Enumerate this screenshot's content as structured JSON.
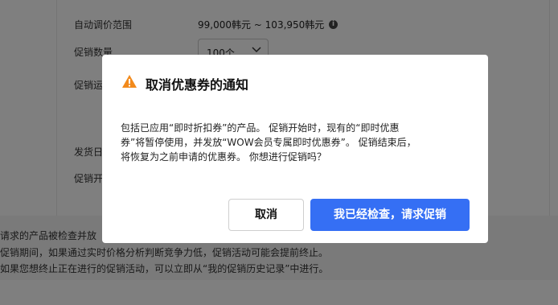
{
  "background": {
    "rows": [
      {
        "label": "自动调价范围",
        "value": "99,000韩元 ~ 103,950韩元"
      },
      {
        "label": "促销数量",
        "value": "100个"
      },
      {
        "label": "促销运",
        "value": ""
      },
      {
        "label": "发货日",
        "value": ""
      },
      {
        "label": "促销开",
        "value": ""
      }
    ],
    "notice_lines": [
      "请求的产品被检查并放",
      "促销期间，如果通过实时价格分析判断竞争力低，促销活动可能会提前终止。",
      "如果您想终止正在进行的促销活动，可以立即从“我的促销历史记录”中进行。"
    ]
  },
  "modal": {
    "title": "取消优惠券的通知",
    "body_lines": [
      "包括已应用“即时折扣券”的产品。 促销开始时，现有的“即时优惠",
      "券”将暂停使用，并发放“WOW会员专属即时优惠券”。 促销结束后，",
      "将恢复为之前申请的优惠券。 你想进行促销吗？"
    ],
    "cancel_label": "取消",
    "confirm_label": "我已经检查，请求促销"
  },
  "colors": {
    "accent": "#356ff4",
    "warning": "#f28a1c"
  }
}
